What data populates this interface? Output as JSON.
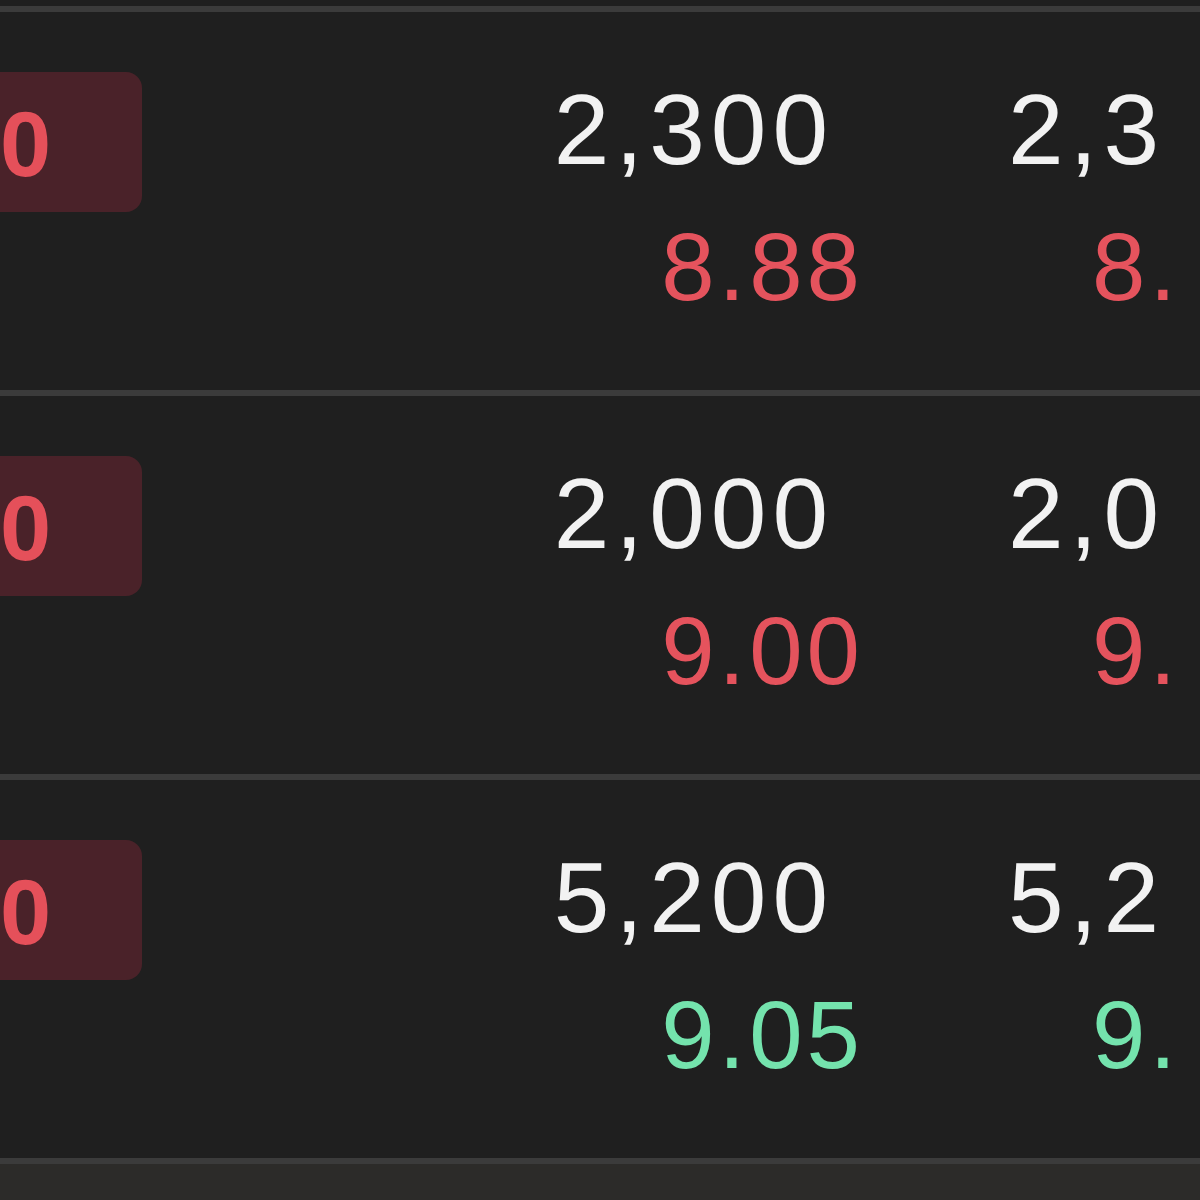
{
  "rows": [
    {
      "badge": "0",
      "columns": [
        {
          "value": "2,300",
          "sub_value": "8.88",
          "color": "#e5535d"
        },
        {
          "value": "2,3",
          "sub_value": "8.",
          "color": "#e5535d"
        }
      ]
    },
    {
      "badge": "0",
      "columns": [
        {
          "value": "2,000",
          "sub_value": "9.00",
          "color": "#e5535d"
        },
        {
          "value": "2,0",
          "sub_value": "9.",
          "color": "#e5535d"
        }
      ]
    },
    {
      "badge": "0",
      "columns": [
        {
          "value": "5,200",
          "sub_value": "9.05",
          "color": "#74e3ad"
        },
        {
          "value": "5,2",
          "sub_value": "9.",
          "color": "#74e3ad"
        }
      ]
    }
  ]
}
